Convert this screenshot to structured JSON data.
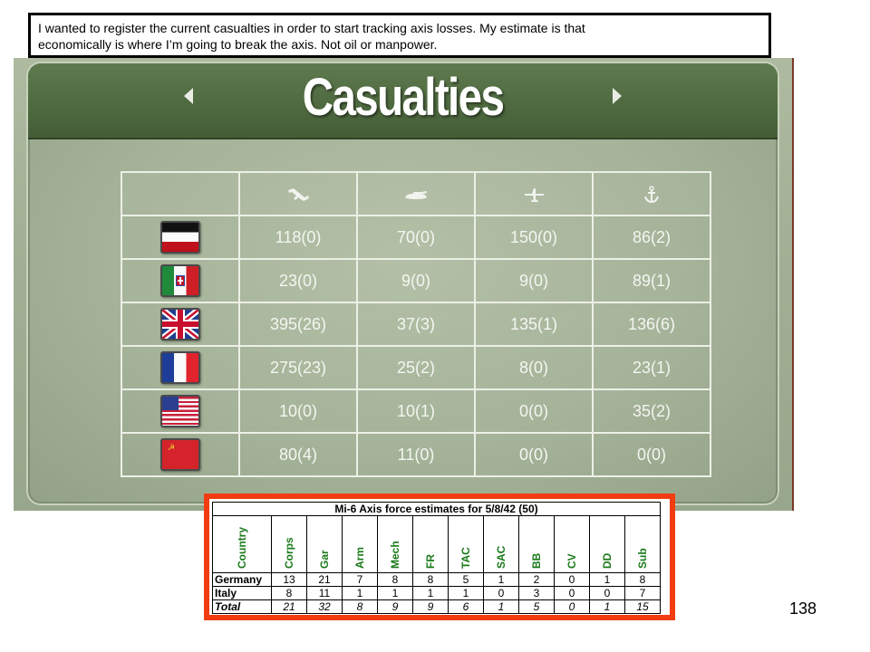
{
  "caption": {
    "line1": "I wanted to register the current casualties in order to start tracking axis losses.   My estimate is that",
    "line2": "economically is where I’m going to break the axis.  Not oil or manpower."
  },
  "screen": {
    "title": "Casualties",
    "columns": [
      {
        "icon": "infantry-icon"
      },
      {
        "icon": "tank-icon"
      },
      {
        "icon": "aircraft-icon"
      },
      {
        "icon": "anchor-icon"
      }
    ],
    "rows": [
      {
        "flag": "germany-flag",
        "values": [
          "118(0)",
          "70(0)",
          "150(0)",
          "86(2)"
        ]
      },
      {
        "flag": "italy-flag",
        "values": [
          "23(0)",
          "9(0)",
          "9(0)",
          "89(1)"
        ]
      },
      {
        "flag": "uk-flag",
        "values": [
          "395(26)",
          "37(3)",
          "135(1)",
          "136(6)"
        ]
      },
      {
        "flag": "france-flag",
        "values": [
          "275(23)",
          "25(2)",
          "8(0)",
          "23(1)"
        ]
      },
      {
        "flag": "usa-flag",
        "values": [
          "10(0)",
          "10(1)",
          "0(0)",
          "35(2)"
        ]
      },
      {
        "flag": "ussr-flag",
        "values": [
          "80(4)",
          "11(0)",
          "0(0)",
          "0(0)"
        ]
      }
    ]
  },
  "mi6": {
    "title": "Mi-6 Axis force estimates for 5/8/42 (50)",
    "headers": [
      "Country",
      "Corps",
      "Gar",
      "Arm",
      "Mech",
      "FR",
      "TAC",
      "SAC",
      "BB",
      "CV",
      "DD",
      "Sub"
    ],
    "rows": [
      {
        "label": "Germany",
        "values": [
          "13",
          "21",
          "7",
          "8",
          "8",
          "5",
          "1",
          "2",
          "0",
          "1",
          "8"
        ]
      },
      {
        "label": "Italy",
        "values": [
          "8",
          "11",
          "1",
          "1",
          "1",
          "1",
          "0",
          "3",
          "0",
          "0",
          "7"
        ]
      },
      {
        "label": "Total",
        "values": [
          "21",
          "32",
          "8",
          "9",
          "9",
          "6",
          "1",
          "5",
          "0",
          "1",
          "15"
        ]
      }
    ]
  },
  "page_number": "138",
  "colors": {
    "header_green": "#4f6a40",
    "panel_green": "#a5b399",
    "mi6_border": "#f23c11",
    "mi6_header_text": "#1a7a1a"
  }
}
